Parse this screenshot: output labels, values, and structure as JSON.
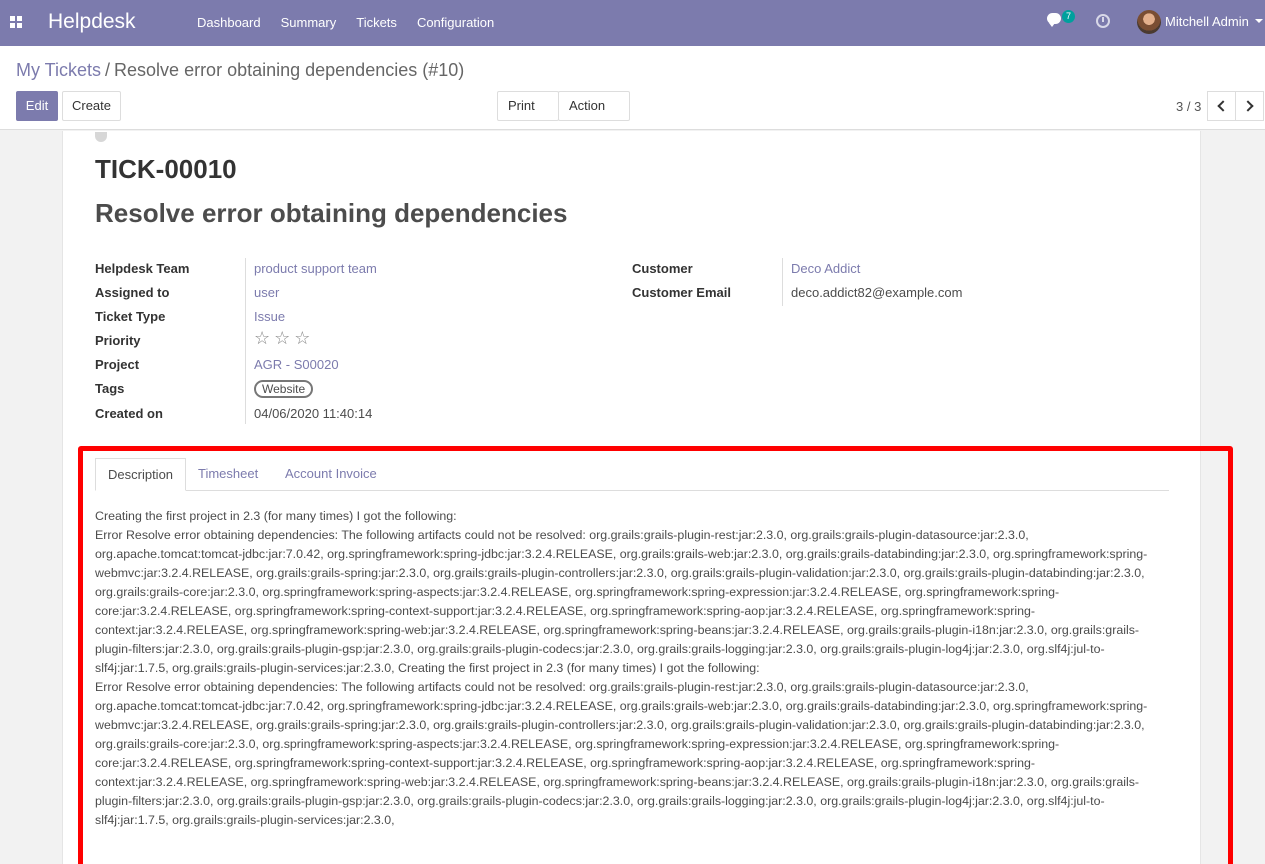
{
  "navbar": {
    "app_title": "Helpdesk",
    "menu": [
      "Dashboard",
      "Summary",
      "Tickets",
      "Configuration"
    ],
    "chat_count": "7",
    "user_name": "Mitchell Admin"
  },
  "breadcrumb": {
    "parent": "My Tickets",
    "separator": "/",
    "current": "Resolve error obtaining dependencies (#10)"
  },
  "toolbar": {
    "edit_label": "Edit",
    "create_label": "Create",
    "print_label": "Print",
    "action_label": "Action",
    "pager": "3 / 3"
  },
  "ticket": {
    "ref": "TICK-00010",
    "name": "Resolve error obtaining dependencies"
  },
  "fields_left": {
    "team_label": "Helpdesk Team",
    "team_value": "product support team",
    "assigned_label": "Assigned to",
    "assigned_value": "user",
    "type_label": "Ticket Type",
    "type_value": "Issue",
    "priority_label": "Priority",
    "priority_stars": 0,
    "priority_max": 3,
    "project_label": "Project",
    "project_value": "AGR - S00020",
    "tags_label": "Tags",
    "tag_value": "Website",
    "created_label": "Created on",
    "created_value": "04/06/2020 11:40:14"
  },
  "fields_right": {
    "customer_label": "Customer",
    "customer_value": "Deco Addict",
    "email_label": "Customer Email",
    "email_value": "deco.addict82@example.com"
  },
  "tabs": {
    "description": "Description",
    "timesheet": "Timesheet",
    "account_invoice": "Account Invoice"
  },
  "description": {
    "line1": "Creating the first project in 2.3 (for many times) I got the following:",
    "para1": "Error Resolve error obtaining dependencies: The following artifacts could not be resolved: org.grails:grails-plugin-rest:jar:2.3.0, org.grails:grails-plugin-datasource:jar:2.3.0, org.apache.tomcat:tomcat-jdbc:jar:7.0.42, org.springframework:spring-jdbc:jar:3.2.4.RELEASE, org.grails:grails-web:jar:2.3.0, org.grails:grails-databinding:jar:2.3.0, org.springframework:spring-webmvc:jar:3.2.4.RELEASE, org.grails:grails-spring:jar:2.3.0, org.grails:grails-plugin-controllers:jar:2.3.0, org.grails:grails-plugin-validation:jar:2.3.0, org.grails:grails-plugin-databinding:jar:2.3.0, org.grails:grails-core:jar:2.3.0, org.springframework:spring-aspects:jar:3.2.4.RELEASE, org.springframework:spring-expression:jar:3.2.4.RELEASE, org.springframework:spring-core:jar:3.2.4.RELEASE, org.springframework:spring-context-support:jar:3.2.4.RELEASE, org.springframework:spring-aop:jar:3.2.4.RELEASE, org.springframework:spring-context:jar:3.2.4.RELEASE, org.springframework:spring-web:jar:3.2.4.RELEASE, org.springframework:spring-beans:jar:3.2.4.RELEASE, org.grails:grails-plugin-i18n:jar:2.3.0, org.grails:grails-plugin-filters:jar:2.3.0, org.grails:grails-plugin-gsp:jar:2.3.0, org.grails:grails-plugin-codecs:jar:2.3.0, org.grails:grails-logging:jar:2.3.0, org.grails:grails-plugin-log4j:jar:2.3.0, org.slf4j:jul-to-slf4j:jar:1.7.5, org.grails:grails-plugin-services:jar:2.3.0, Creating the first project in 2.3 (for many times) I got the following:",
    "para2": "Error Resolve error obtaining dependencies: The following artifacts could not be resolved: org.grails:grails-plugin-rest:jar:2.3.0, org.grails:grails-plugin-datasource:jar:2.3.0, org.apache.tomcat:tomcat-jdbc:jar:7.0.42, org.springframework:spring-jdbc:jar:3.2.4.RELEASE, org.grails:grails-web:jar:2.3.0, org.grails:grails-databinding:jar:2.3.0, org.springframework:spring-webmvc:jar:3.2.4.RELEASE, org.grails:grails-spring:jar:2.3.0, org.grails:grails-plugin-controllers:jar:2.3.0, org.grails:grails-plugin-validation:jar:2.3.0, org.grails:grails-plugin-databinding:jar:2.3.0, org.grails:grails-core:jar:2.3.0, org.springframework:spring-aspects:jar:3.2.4.RELEASE, org.springframework:spring-expression:jar:3.2.4.RELEASE, org.springframework:spring-core:jar:3.2.4.RELEASE, org.springframework:spring-context-support:jar:3.2.4.RELEASE, org.springframework:spring-aop:jar:3.2.4.RELEASE, org.springframework:spring-context:jar:3.2.4.RELEASE, org.springframework:spring-web:jar:3.2.4.RELEASE, org.springframework:spring-beans:jar:3.2.4.RELEASE, org.grails:grails-plugin-i18n:jar:2.3.0, org.grails:grails-plugin-filters:jar:2.3.0, org.grails:grails-plugin-gsp:jar:2.3.0, org.grails:grails-plugin-codecs:jar:2.3.0, org.grails:grails-logging:jar:2.3.0, org.grails:grails-plugin-log4j:jar:2.3.0, org.slf4j:jul-to-slf4j:jar:1.7.5, org.grails:grails-plugin-services:jar:2.3.0,"
  },
  "colors": {
    "navbar": "#7c7bad",
    "accent": "#7c7bad",
    "badge": "#00a09d",
    "highlight": "#ff0000"
  }
}
